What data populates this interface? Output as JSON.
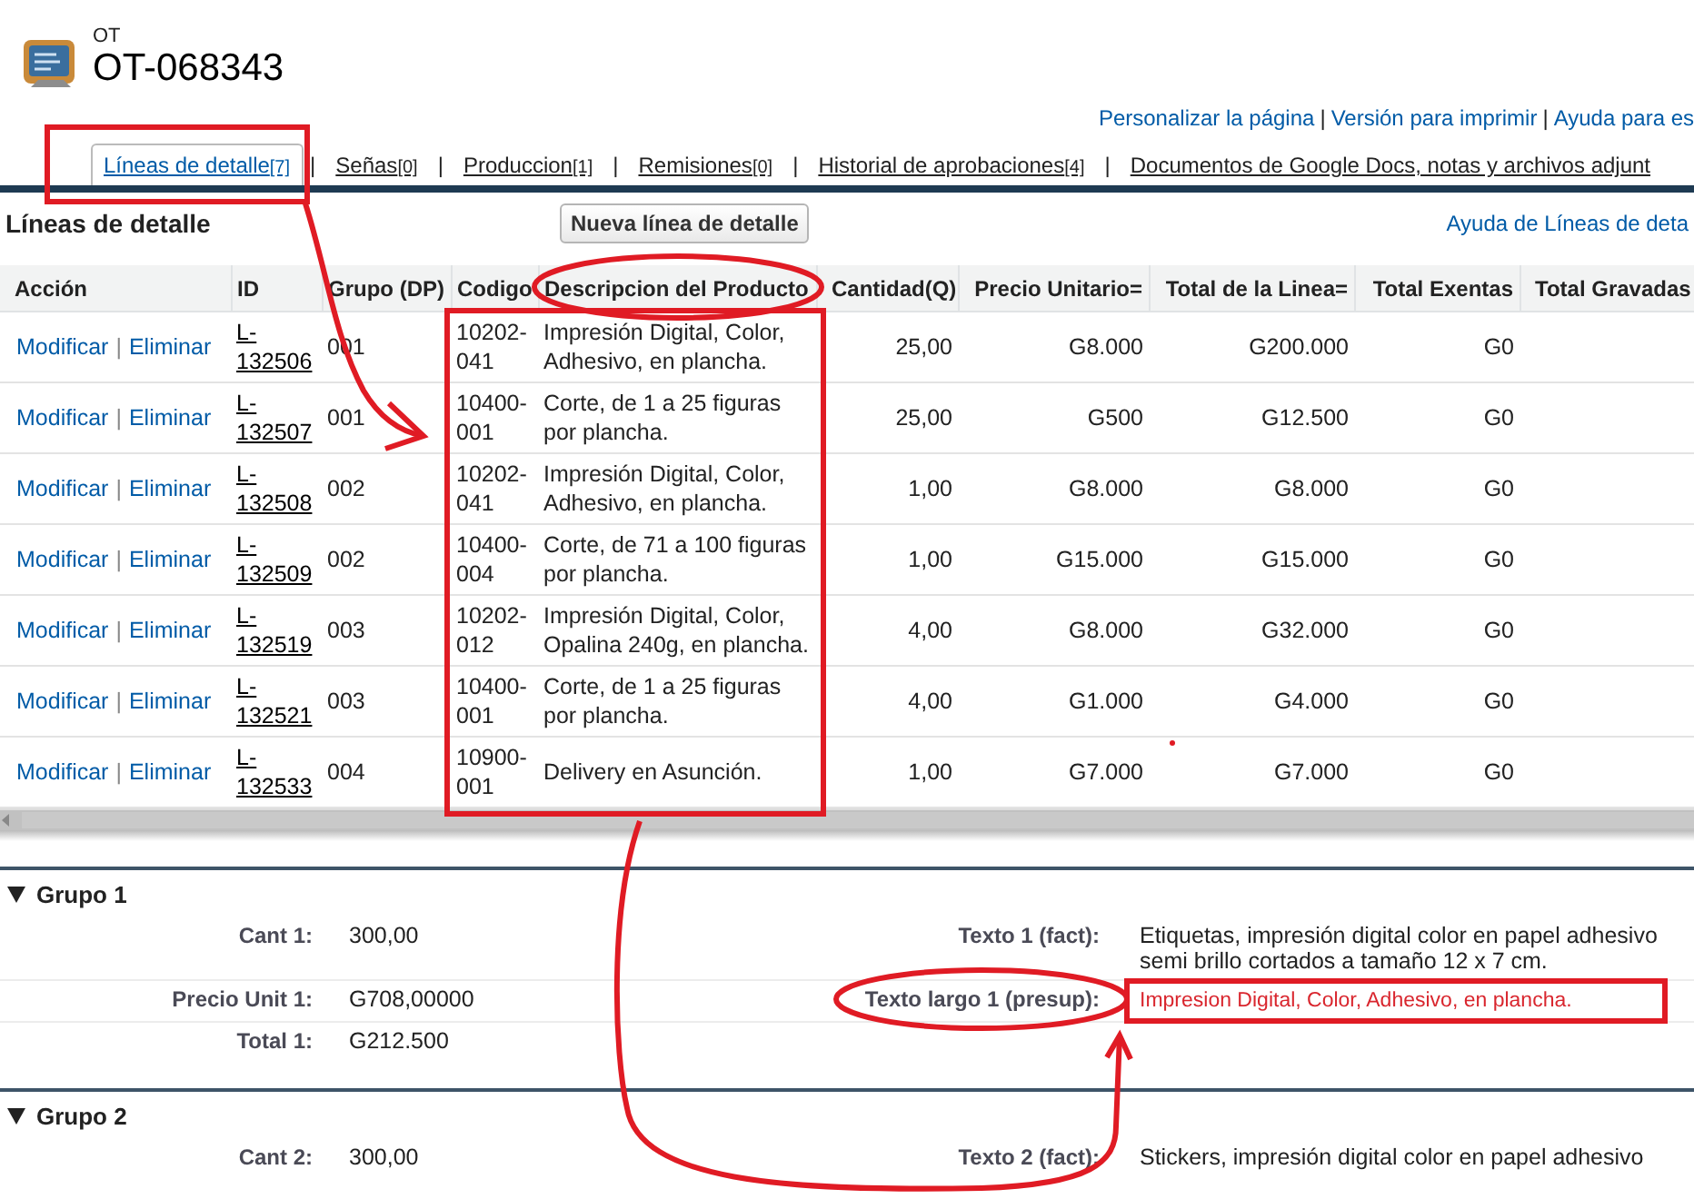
{
  "header": {
    "object_type": "OT",
    "record_name": "OT-068343"
  },
  "separator": "|",
  "page_links": [
    "Personalizar la página",
    "Versión para imprimir",
    "Ayuda para es"
  ],
  "tabs": [
    {
      "label": "Líneas de detalle",
      "count": "[7]",
      "selected": true
    },
    {
      "label": "Señas",
      "count": "[0]",
      "selected": false
    },
    {
      "label": "Produccion",
      "count": "[1]",
      "selected": false
    },
    {
      "label": "Remisiones",
      "count": "[0]",
      "selected": false
    },
    {
      "label": "Historial de aprobaciones",
      "count": "[4]",
      "selected": false
    },
    {
      "label": "Documentos de Google Docs, notas y archivos adjunt",
      "selected": false
    }
  ],
  "related_list": {
    "title": "Líneas de detalle",
    "new_button": "Nueva línea de detalle",
    "help_link": "Ayuda de Líneas de deta",
    "columns": [
      "Acción",
      "ID",
      "Grupo (DP)",
      "Codigo",
      "Descripcion del Producto",
      "Cantidad(Q)",
      "Precio Unitario=",
      "Total de la Linea=",
      "Total Exentas",
      "Total Gravadas"
    ],
    "rows": [
      {
        "edit": "Modificar",
        "delete": "Eliminar",
        "id": "L-132506",
        "group": "001",
        "code": "10202-041",
        "description": "Impresión Digital, Color, Adhesivo, en plancha.",
        "quantity": "25,00",
        "unit_price": "G8.000",
        "line_total": "G200.000",
        "exempt_total": "G0"
      },
      {
        "edit": "Modificar",
        "delete": "Eliminar",
        "id": "L-132507",
        "group": "001",
        "code": "10400-001",
        "description": "Corte, de 1 a 25 figuras por plancha.",
        "quantity": "25,00",
        "unit_price": "G500",
        "line_total": "G12.500",
        "exempt_total": "G0"
      },
      {
        "edit": "Modificar",
        "delete": "Eliminar",
        "id": "L-132508",
        "group": "002",
        "code": "10202-041",
        "description": "Impresión Digital, Color, Adhesivo, en plancha.",
        "quantity": "1,00",
        "unit_price": "G8.000",
        "line_total": "G8.000",
        "exempt_total": "G0"
      },
      {
        "edit": "Modificar",
        "delete": "Eliminar",
        "id": "L-132509",
        "group": "002",
        "code": "10400-004",
        "description": "Corte, de 71 a 100 figuras por plancha.",
        "quantity": "1,00",
        "unit_price": "G15.000",
        "line_total": "G15.000",
        "exempt_total": "G0"
      },
      {
        "edit": "Modificar",
        "delete": "Eliminar",
        "id": "L-132519",
        "group": "003",
        "code": "10202-012",
        "description": "Impresión Digital, Color, Opalina 240g, en plancha.",
        "quantity": "4,00",
        "unit_price": "G8.000",
        "line_total": "G32.000",
        "exempt_total": "G0"
      },
      {
        "edit": "Modificar",
        "delete": "Eliminar",
        "id": "L-132521",
        "group": "003",
        "code": "10400-001",
        "description": "Corte, de 1 a 25 figuras por plancha.",
        "quantity": "4,00",
        "unit_price": "G1.000",
        "line_total": "G4.000",
        "exempt_total": "G0"
      },
      {
        "edit": "Modificar",
        "delete": "Eliminar",
        "id": "L-132533",
        "group": "004",
        "code": "10900-001",
        "description": "Delivery en Asunción.",
        "quantity": "1,00",
        "unit_price": "G7.000",
        "line_total": "G7.000",
        "exempt_total": "G0"
      }
    ]
  },
  "groups": [
    {
      "title": "Grupo 1",
      "expanded": true,
      "rows": [
        {
          "left": {
            "label": "Cant 1:",
            "value": "300,00"
          },
          "right": {
            "label": "Texto 1 (fact):",
            "value": "Etiquetas, impresión digital color en papel adhesivo semi brillo cortados a tamaño 12 x 7 cm."
          }
        },
        {
          "left": {
            "label": "Precio Unit 1:",
            "value": "G708,00000"
          },
          "right": {
            "label": "Texto largo 1 (presup):",
            "value": "Impresion Digital, Color, Adhesivo, en plancha.",
            "color": "#d9262e"
          }
        },
        {
          "left": {
            "label": "Total 1:",
            "value": "G212.500"
          }
        }
      ]
    },
    {
      "title": "Grupo 2",
      "expanded": true,
      "rows": [
        {
          "left": {
            "label": "Cant 2:",
            "value": "300,00"
          },
          "right": {
            "label": "Texto 2 (fact):",
            "value": "Stickers, impresión digital color en papel adhesivo"
          }
        }
      ]
    }
  ]
}
